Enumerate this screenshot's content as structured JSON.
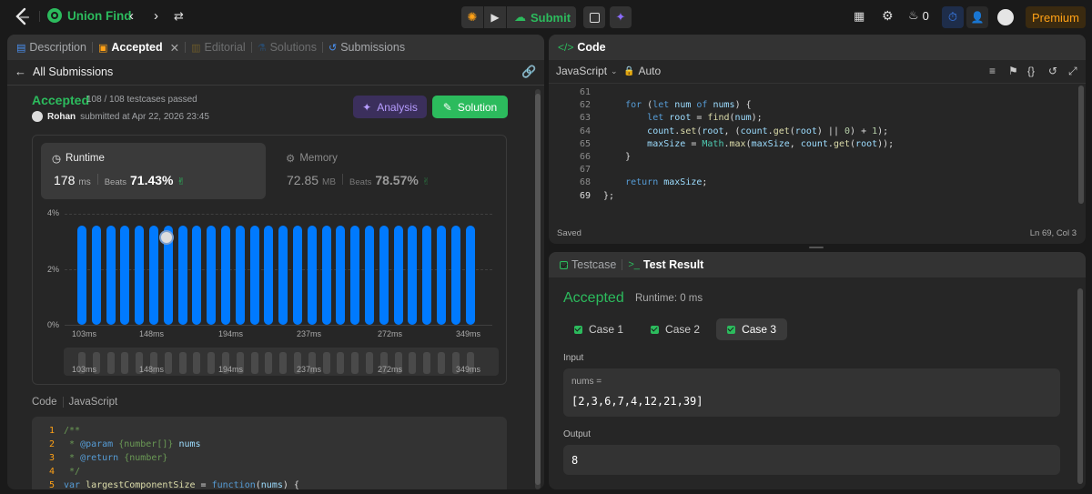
{
  "topbar": {
    "problem_title": "Union Find",
    "submit_label": "Submit",
    "streak_count": "0",
    "premium_label": "Premium"
  },
  "left_tabs": [
    {
      "label": "Description"
    },
    {
      "label": "Accepted"
    },
    {
      "label": "Editorial"
    },
    {
      "label": "Solutions"
    },
    {
      "label": "Submissions"
    }
  ],
  "submission": {
    "back_label": "All Submissions",
    "status": "Accepted",
    "testcases": "108 / 108 testcases passed",
    "user": "Rohan",
    "submitted_at": "submitted at Apr 22, 2026 23:45",
    "analysis_label": "Analysis",
    "solution_label": "Solution"
  },
  "runtime": {
    "label": "Runtime",
    "value": "178",
    "unit": "ms",
    "beats_label": "Beats",
    "beats": "71.43%"
  },
  "memory": {
    "label": "Memory",
    "value": "72.85",
    "unit": "MB",
    "beats_label": "Beats",
    "beats": "78.57%"
  },
  "chart_data": {
    "type": "bar",
    "ytick_labels": [
      "4%",
      "2%",
      "0%"
    ],
    "xtick_labels": [
      "103ms",
      "148ms",
      "194ms",
      "237ms",
      "272ms",
      "349ms"
    ],
    "mini_xtick_labels": [
      "103ms",
      "148ms",
      "194ms",
      "237ms",
      "272ms",
      "349ms"
    ],
    "ylim": [
      0,
      4
    ],
    "values": [
      3.57,
      3.57,
      3.57,
      3.57,
      3.57,
      3.57,
      3.57,
      3.57,
      3.57,
      3.57,
      3.57,
      3.57,
      3.57,
      3.57,
      3.57,
      3.57,
      3.57,
      3.57,
      3.57,
      3.57,
      3.57,
      3.57,
      3.57,
      3.57,
      3.57,
      3.57,
      3.57,
      3.57
    ],
    "marker_bar_index": 6,
    "bar_color": "#007aff",
    "grid": true
  },
  "code_section": {
    "label": "Code",
    "language": "JavaScript"
  },
  "left_code": [
    {
      "n": "1",
      "html": "<span class='cm'>/**</span>"
    },
    {
      "n": "2",
      "html": "<span class='cm'> * <span style=\"color:#569cd6\">@param</span> {number[]} <span style=\"color:#9cdcfe\">nums</span></span>"
    },
    {
      "n": "3",
      "html": "<span class='cm'> * <span style=\"color:#569cd6\">@return</span> {number}</span>"
    },
    {
      "n": "4",
      "html": "<span class='cm'> */</span>"
    },
    {
      "n": "5",
      "html": "<span class='kw'>var</span> <span class='fn'>largestComponentSize</span> = <span class='kw'>function</span>(<span class='vr'>nums</span>) {"
    }
  ],
  "editor": {
    "title": "Code",
    "language": "JavaScript",
    "mode": "Auto",
    "saved": "Saved",
    "cursor": "Ln 69, Col 3"
  },
  "editor_lines": [
    {
      "n": "61",
      "html": ""
    },
    {
      "n": "62",
      "html": "    <span class='kw'>for</span> (<span class='kw'>let</span> <span class='vr'>num</span> <span class='kw'>of</span> <span class='vr'>nums</span>) {"
    },
    {
      "n": "63",
      "html": "        <span class='kw'>let</span> <span class='vr'>root</span> = <span class='fn'>find</span>(<span class='vr'>num</span>);"
    },
    {
      "n": "64",
      "html": "        <span class='vr'>count</span>.<span class='fn'>set</span>(<span class='vr'>root</span>, (<span class='vr'>count</span>.<span class='fn'>get</span>(<span class='vr'>root</span>) || <span class='nm'>0</span>) + <span class='nm'>1</span>);"
    },
    {
      "n": "65",
      "html": "        <span class='vr'>maxSize</span> = <span class='ob'>Math</span>.<span class='fn'>max</span>(<span class='vr'>maxSize</span>, <span class='vr'>count</span>.<span class='fn'>get</span>(<span class='vr'>root</span>));"
    },
    {
      "n": "66",
      "html": "    }"
    },
    {
      "n": "67",
      "html": ""
    },
    {
      "n": "68",
      "html": "    <span class='kw'>return</span> <span class='vr'>maxSize</span>;"
    },
    {
      "n": "69",
      "html": "};"
    }
  ],
  "result_tabs": {
    "testcase": "Testcase",
    "test_result": "Test Result"
  },
  "result": {
    "status": "Accepted",
    "runtime": "Runtime: 0 ms",
    "cases": [
      "Case 1",
      "Case 2",
      "Case 3"
    ],
    "input_label": "Input",
    "param_name": "nums =",
    "param_value": "[2,3,6,7,4,12,21,39]",
    "output_label": "Output",
    "output_value": "8"
  },
  "colors": {
    "accent_green": "#2cbb5d",
    "bar_blue": "#007aff",
    "premium": "#ffa116"
  }
}
